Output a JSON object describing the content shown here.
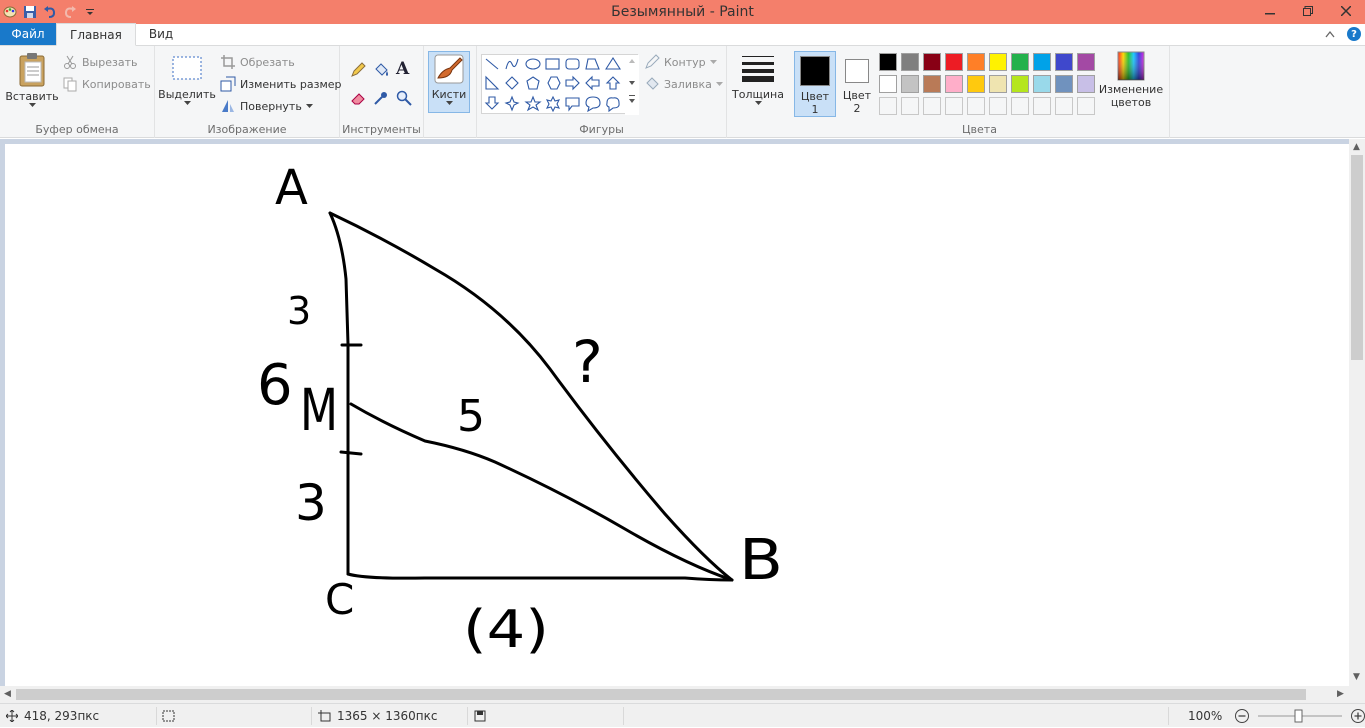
{
  "window": {
    "title": "Безымянный - Paint",
    "qat_icons": [
      "paint-app-icon",
      "save-icon",
      "undo-icon",
      "redo-icon",
      "customize-qat-icon"
    ]
  },
  "tabs": {
    "file": "Файл",
    "home": "Главная",
    "view": "Вид",
    "help": "?"
  },
  "ribbon": {
    "clipboard": {
      "paste": "Вставить",
      "cut": "Вырезать",
      "copy": "Копировать",
      "group": "Буфер обмена"
    },
    "image": {
      "select": "Выделить",
      "crop": "Обрезать",
      "resize": "Изменить размер",
      "rotate": "Повернуть",
      "group": "Изображение"
    },
    "tools": {
      "group": "Инструменты",
      "text_tool": "A"
    },
    "brushes": {
      "label": "Кисти"
    },
    "shapes": {
      "outline": "Контур",
      "fill": "Заливка",
      "group": "Фигуры"
    },
    "size": {
      "label": "Толщина"
    },
    "colors": {
      "color1_line1": "Цвет",
      "color1_line2": "1",
      "color2_line1": "Цвет",
      "color2_line2": "2",
      "edit_line1": "Изменение",
      "edit_line2": "цветов",
      "group": "Цвета",
      "color1_value": "#000000",
      "color2_value": "#ffffff",
      "palette_row1": [
        "#000000",
        "#7f7f7f",
        "#880015",
        "#ed1c24",
        "#ff7f27",
        "#fff200",
        "#22b14c",
        "#00a2e8",
        "#3f48cc",
        "#a349a4"
      ],
      "palette_row2": [
        "#ffffff",
        "#c3c3c3",
        "#b97a57",
        "#ffaec9",
        "#ffc90e",
        "#efe4b0",
        "#b5e61d",
        "#99d9ea",
        "#7092be",
        "#c8bfe7"
      ]
    }
  },
  "drawing": {
    "label_a": "A",
    "label_c": "C",
    "label_b": "B",
    "label_m": "M",
    "label_6": "6",
    "label_3_top": "3",
    "label_3_bottom": "3",
    "label_5": "5",
    "label_4": "(4)",
    "label_question": "?"
  },
  "status": {
    "cursor": "418, 293пкс",
    "size": "1365 × 1360пкс",
    "zoom": "100%"
  }
}
